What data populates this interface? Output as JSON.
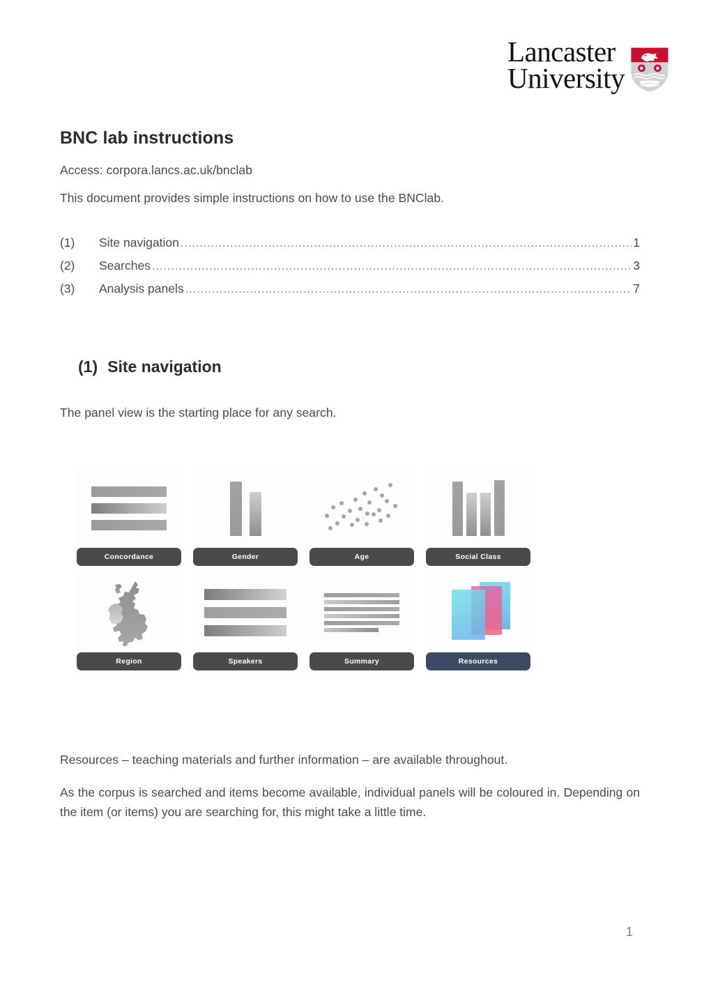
{
  "logo": {
    "line1": "Lancaster",
    "line2": "University",
    "crest_name": "lancaster-university-crest",
    "crest_red": "#c8102e"
  },
  "document": {
    "title": "BNC lab instructions",
    "access_line": "Access: corpora.lancs.ac.uk/bnclab",
    "intro": "This document provides simple instructions on how to use the BNClab.",
    "page_number": "1"
  },
  "toc": {
    "entries": [
      {
        "number": "(1)",
        "label": "Site navigation",
        "page": "1"
      },
      {
        "number": "(2)",
        "label": "Searches",
        "page": "3"
      },
      {
        "number": "(3)",
        "label": "Analysis panels",
        "page": "7"
      }
    ],
    "leader": "........................................................................................................................................................................................................."
  },
  "section": {
    "number": "(1)",
    "title": "Site navigation",
    "body_intro": "The panel view is the starting place for any search.",
    "note_resources": "Resources – teaching materials and further information – are available throughout.",
    "note_colouring": "As the corpus is searched and items become available, individual panels will be coloured in. Depending on the item (or items) you are searching for, this might take a little time."
  },
  "panels": [
    {
      "label": "Concordance",
      "art": "horizontal-bars",
      "accent": false
    },
    {
      "label": "Gender",
      "art": "vertical-bars-2",
      "accent": false
    },
    {
      "label": "Age",
      "art": "scatter-plot",
      "accent": false
    },
    {
      "label": "Social Class",
      "art": "vertical-bars-4",
      "accent": false
    },
    {
      "label": "Region",
      "art": "uk-ireland-map",
      "accent": false
    },
    {
      "label": "Speakers",
      "art": "wide-bars",
      "accent": false
    },
    {
      "label": "Summary",
      "art": "text-lines",
      "accent": false
    },
    {
      "label": "Resources",
      "art": "card-stack",
      "accent": true
    }
  ],
  "colors": {
    "label_bar": "#4a4a4a",
    "resources_bar": "#3c4a63",
    "body_text": "#4a4a4a",
    "heading_text": "#2b2b2b"
  }
}
